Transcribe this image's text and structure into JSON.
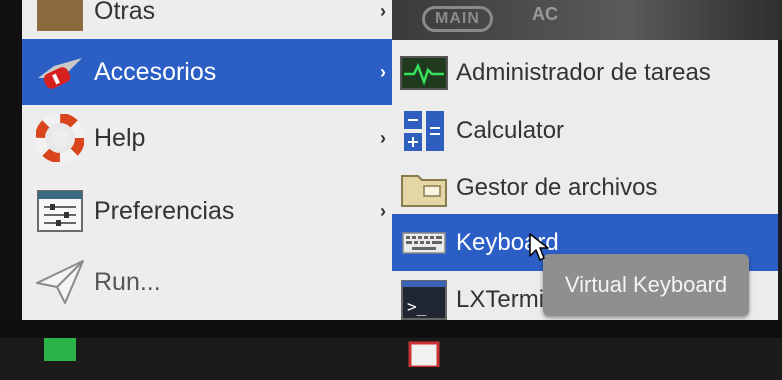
{
  "desktop": {
    "logo_text": "MAIN",
    "logo_text_2": "AC"
  },
  "menu": {
    "items": [
      {
        "label": "Otras",
        "icon": "folder-icon",
        "has_submenu": true
      },
      {
        "label": "Accesorios",
        "icon": "swiss-knife-icon",
        "has_submenu": true,
        "selected": true
      },
      {
        "label": "Help",
        "icon": "lifebuoy-icon",
        "has_submenu": true
      },
      {
        "label": "Preferencias",
        "icon": "sliders-icon",
        "has_submenu": true
      },
      {
        "label": "Run...",
        "icon": "paper-plane-icon",
        "has_submenu": false
      },
      {
        "label": "",
        "icon": "green-app-icon",
        "has_submenu": false
      }
    ],
    "arrow_glyph": "›"
  },
  "submenu": {
    "items": [
      {
        "label": "Administrador de tareas",
        "icon": "task-manager-icon"
      },
      {
        "label": "Calculator",
        "icon": "calculator-icon"
      },
      {
        "label": "Gestor de archivos",
        "icon": "file-manager-icon"
      },
      {
        "label": "Keyboard",
        "icon": "keyboard-icon",
        "selected": true
      },
      {
        "label": "LXTermir",
        "icon": "terminal-icon"
      },
      {
        "label": "",
        "icon": "red-app-icon"
      }
    ]
  },
  "tooltip": {
    "text": "Virtual Keyboard"
  },
  "colors": {
    "selection": "#2c5fc6",
    "menu_bg": "#ededed",
    "tooltip_bg": "#8f8f8f"
  }
}
